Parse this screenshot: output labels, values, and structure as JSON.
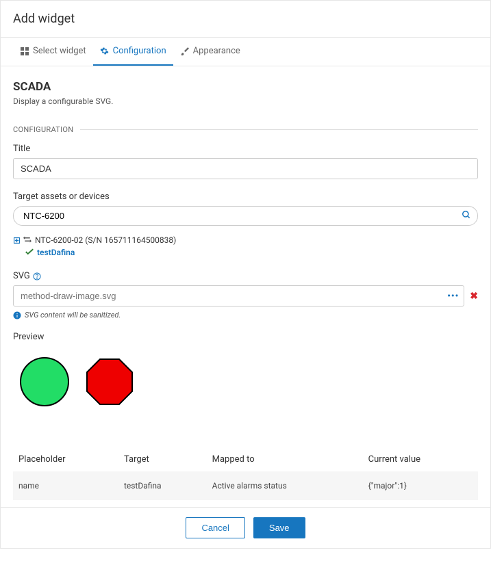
{
  "header": {
    "title": "Add widget"
  },
  "tabs": {
    "select": "Select widget",
    "config": "Configuration",
    "appearance": "Appearance"
  },
  "widget": {
    "name": "SCADA",
    "description": "Display a configurable SVG."
  },
  "section": {
    "configuration": "CONFIGURATION"
  },
  "fields": {
    "title_label": "Title",
    "title_value": "SCADA",
    "target_label": "Target assets or devices",
    "target_value": "NTC-6200",
    "svg_label": "SVG",
    "svg_placeholder": "method-draw-image.svg",
    "svg_info": "SVG content will be sanitized.",
    "preview_label": "Preview"
  },
  "tree": {
    "parent": "NTC-6200-02 (S/N 165711164500838)",
    "child": "testDafina"
  },
  "table": {
    "headers": [
      "Placeholder",
      "Target",
      "Mapped to",
      "Current value"
    ],
    "row": [
      "name",
      "testDafina",
      "Active alarms status",
      "{\"major\":1}"
    ]
  },
  "footer": {
    "cancel": "Cancel",
    "save": "Save"
  }
}
